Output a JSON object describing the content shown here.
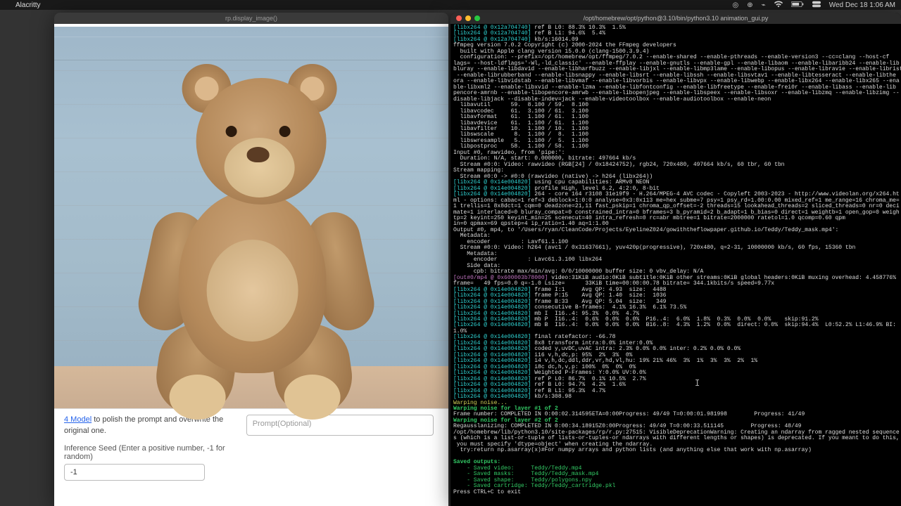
{
  "menubar": {
    "app": "Alacritty",
    "clock": "Wed Dec 18  1:06 AM"
  },
  "left": {
    "title": "rp.display_image()",
    "helper_link_text": "4 Model",
    "helper_rest_1": " to polish the prompt and overwrite the original one.",
    "prompt_placeholder": "Prompt(Optional)",
    "seed_label": "Inference Seed (Enter a positive number, -1 for random)",
    "seed_value": "-1"
  },
  "term": {
    "title": "/opt/homebrew/opt/python@3.10/bin/python3.10 animation_gui.py",
    "tag": "[libx264 @ 0x12a704740]",
    "tag2": "[libx264 @ 0x14e004820]",
    "tag_mp4": "[out#0/mp4 @ 0x600003b78000]",
    "l01": " ref B L0: 88.3% 10.3%  1.5%",
    "l02": " ref B L1: 94.6%  5.4%",
    "l03": " kb/s:16014.09",
    "ffver": "ffmpeg version 7.0.2 Copyright (c) 2000-2024 the FFmpeg developers",
    "built": "  built with Apple clang version 15.0.0 (clang-1500.3.9.4)",
    "conf": "  configuration: --prefix=/opt/homebrew/opt/ffmpeg/7.0.2 --enable-shared --enable-pthreads --enable-version3 --cc=clang --host-cf\nlags= --host-ldflags='-Wl,-ld_classic' --enable-ffplay --enable-gnutls --enable-gpl --enable-libaom --enable-libaribb24 --enable-lib\nbluray --enable-libdav1d --enable-libharfbuzz --enable-libjxl --enable-libmp3lame --enable-libopus --enable-librav1e --enable-librist\n --enable-librubberband --enable-libsnappy --enable-libsrt --enable-libssh --enable-libsvtav1 --enable-libtesseract --enable-libthe\nora --enable-libvidstab --enable-libvmaf --enable-libvorbis --enable-libvpx --enable-libwebp --enable-libx264 --enable-libx265 --ena\nble-libxml2 --enable-libxvid --enable-lzma --enable-libfontconfig --enable-libfreetype --enable-frei0r --enable-libass --enable-lib\npencore-amrnb --enable-libopencore-amrwb --enable-libopenjpeg --enable-libspeex --enable-libsoxr --enable-libzmq --enable-libzimg --\ndisable-libjack --disable-indev=jack --enable-videotoolbox --enable-audiotoolbox --enable-neon",
    "lib01": "  libavutil      59.  8.100 / 59.  8.100",
    "lib02": "  libavcodec     61.  3.100 / 61.  3.100",
    "lib03": "  libavformat    61.  1.100 / 61.  1.100",
    "lib04": "  libavdevice    61.  1.100 / 61.  1.100",
    "lib05": "  libavfilter    10.  1.100 / 10.  1.100",
    "lib06": "  libswscale      8.  1.100 /  8.  1.100",
    "lib07": "  libswresample   5.  1.100 /  5.  1.100",
    "lib08": "  libpostproc    58.  1.100 / 58.  1.100",
    "inp0": "Input #0, rawvideo, from 'pipe:':",
    "dur": "  Duration: N/A, start: 0.000000, bitrate: 497664 kb/s",
    "str0": "  Stream #0:0: Video: rawvideo (RGB[24] / 0x18424752), rgb24, 720x480, 497664 kb/s, 60 tbr, 60 tbn",
    "smap": "Stream mapping:",
    "smap1": "  Stream #0:0 -> #0:0 (rawvideo (native) -> h264 (libx264))",
    "cpu": " using cpu capabilities: ARMv8 NEON",
    "prof": " profile High, level 6.2, 4:2:0, 8-bit",
    "x264v": " 264 - core 164 r3108 31e19f9 - H.264/MPEG-4 AVC codec - Copyleft 2003-2023 - http://www.videolan.org/x264.ht",
    "x264o": "ml - options: cabac=1 ref=3 deblock=1:0:0 analyse=0x3:0x113 me=hex subme=7 psy=1 psy_rd=1.00:0.00 mixed_ref=1 me_range=16 chroma_me=\n1 trellis=1 8x8dct=1 cqm=0 deadzone=21,11 fast_pskip=1 chroma_qp_offset=-2 threads=15 lookahead_threads=2 sliced_threads=0 nr=0 deci\nmate=1 interlaced=0 bluray_compat=0 constrained_intra=0 bframes=3 b_pyramid=2 b_adapt=1 b_bias=0 direct=1 weightb=1 open_gop=0 weigh\ntp=2 keyint=250 keyint_min=25 scenecut=40 intra_refresh=0 rc=abr mbtree=1 bitrate=2000000 ratetol=1.0 qcomp=0.60 qpm\nin=0 qpmax=69 qpstep=4 ip_ratio=1.40 aq=1:1.00",
    "out0": "Output #0, mp4, to '/Users/ryan/CleanCode/Projects/EyelineZ024/gowiththeflowpaper.github.io/Teddy/Teddy_mask.mp4':",
    "meta": "  Metadata:",
    "enc": "    encoder         : Lavf61.1.100",
    "ostr": "  Stream #0:0: Video: h264 (avc1 / 0x31637661), yuv420p(progressive), 720x480, q=2-31, 10000000 kb/s, 60 fps, 15360 tbn",
    "meta2": "    Metadata:",
    "enc2": "      encoder         : Lavc61.3.100 libx264",
    "side": "    Side data:",
    "cpb": "      cpb: bitrate max/min/avg: 0/0/10000000 buffer size: 0 vbv_delay: N/A",
    "mux": " video:31KiB audio:0KiB subtitle:0KiB other streams:0KiB global headers:0KiB muxing overhead: 4.458776%",
    "frame": "frame=   49 fps=0.0 q=-1.0 Lsize=      33KiB time=00:00:00.78 bitrate= 344.1kbits/s speed=9.77x",
    "fi": " frame I:1     Avg QP: 4.93  size:  4488",
    "fp": " frame P:15    Avg QP: 1.40  size:  1036",
    "fb": " frame B:33    Avg QP: 5.04  size:   349",
    "cb": " consecutive B-frames:  4.1% 16.3%  6.1% 73.5%",
    "mbi": " mb I  I16..4: 95.3%  0.0%  4.7%",
    "mbp": " mb P  I16..4:  0.6%  0.0%  0.0%  P16..4:  6.0%  1.8%  0.3%  0.0%  0.0%    skip:91.2%",
    "mbb": " mb B  I16..4:  0.0%  0.0%  0.0%  B16..8:  4.3%  1.2%  0.0%  direct: 0.0%  skip:94.4%  L0:52.2% L1:46.9% BI:",
    "mbb2": "1.0%",
    "rate": " final ratefactor: -66.78",
    "t8x8": " 8x8 transform intra:0.0% inter:0.0%",
    "cod": " coded y,uvDC,uvAC intra: 2.3% 0.0% 0.0% inter: 0.2% 0.0% 0.0%",
    "i16": " i16 v,h,dc,p: 95%  2%  3%  0%",
    "i4": " i4 v,h,dc,ddl,ddr,vr,hd,vl,hu: 19% 21% 46%  3%  1%  3%  3%  2%  1%",
    "i8c": " i8c dc,h,v,p: 100%  0%  0%  0%",
    "wp": " Weighted P-Frames: Y:0.0% UV:0.0%",
    "rp": " ref P L0: 86.7%  0.1% 10.5%  2.7%",
    "rb0": " ref B L0: 94.7%  4.2%  1.6%",
    "rb1": " ref B L1: 95.3%  4.7%",
    "kb": " kb/s:308.98",
    "warp": "Warping noise...",
    "wn1": "Warping noise for layer #1 of 2",
    "fnum": "Frame number: COMPLETED IN 0:00:02.314595ETA=0:00Progress: 49/49 T=0:00:01.981998        Progress: 41/49",
    "wn2": "Warping noise for layer #2 of 2",
    "reg": "Regausslanizing: COMPLETED IN 0:00:34.18915Z0:00Progress: 49/49 T=0:00:33.511145        Progress: 48/49",
    "dep": "/opt/homebrew/lib/python3.10/site-packages/rp/r.py:27515: VisibleDeprecationWarning: Creating an ndarray from ragged nested sequence\ns (which is a list-or-tuple of lists-or-tuples-or ndarrays with different lengths or shapes) is deprecated. If you meant to do this,\n you must specify 'dtype=object' when creating the ndarray.\n  try:return np.asarray(x)#For numpy arrays and python lists (and anything else that work with np.asarray)",
    "sav": "Saved outputs:",
    "sv": "    - Saved video:     Teddy/Teddy.mp4",
    "sm": "    - Saved masks:     Teddy/Teddy_mask.mp4",
    "ss": "    - Saved shape:     Teddy/polygons.npy",
    "sc": "    - Saved cartridge: Teddy/Teddy_cartridge.pkl",
    "exit": "Press CTRL+C to exit"
  }
}
